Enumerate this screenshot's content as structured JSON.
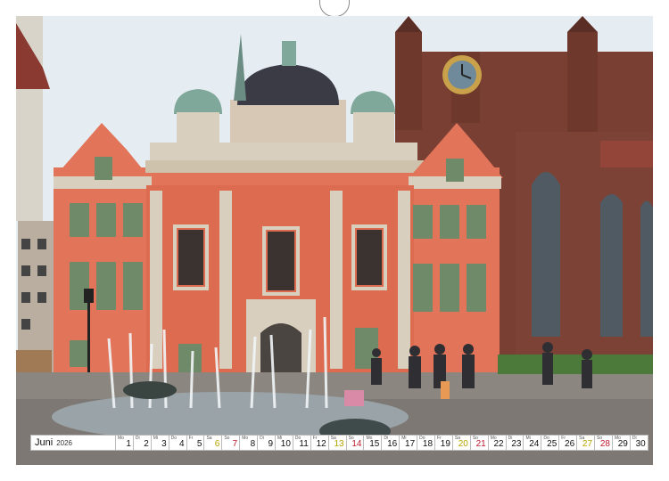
{
  "calendar": {
    "month": "Juni",
    "year": "2026",
    "days": [
      {
        "n": "1",
        "wd": "Mo",
        "type": "work"
      },
      {
        "n": "2",
        "wd": "Di",
        "type": "work"
      },
      {
        "n": "3",
        "wd": "Mi",
        "type": "work"
      },
      {
        "n": "4",
        "wd": "Do",
        "type": "work"
      },
      {
        "n": "5",
        "wd": "Fr",
        "type": "work"
      },
      {
        "n": "6",
        "wd": "Sa",
        "type": "sat"
      },
      {
        "n": "7",
        "wd": "So",
        "type": "sun"
      },
      {
        "n": "8",
        "wd": "Mo",
        "type": "work"
      },
      {
        "n": "9",
        "wd": "Di",
        "type": "work"
      },
      {
        "n": "10",
        "wd": "Mi",
        "type": "work"
      },
      {
        "n": "11",
        "wd": "Do",
        "type": "work"
      },
      {
        "n": "12",
        "wd": "Fr",
        "type": "work"
      },
      {
        "n": "13",
        "wd": "Sa",
        "type": "sat"
      },
      {
        "n": "14",
        "wd": "So",
        "type": "sun"
      },
      {
        "n": "15",
        "wd": "Mo",
        "type": "work"
      },
      {
        "n": "16",
        "wd": "Di",
        "type": "work"
      },
      {
        "n": "17",
        "wd": "Mi",
        "type": "work"
      },
      {
        "n": "18",
        "wd": "Do",
        "type": "work"
      },
      {
        "n": "19",
        "wd": "Fr",
        "type": "work"
      },
      {
        "n": "20",
        "wd": "Sa",
        "type": "sat"
      },
      {
        "n": "21",
        "wd": "So",
        "type": "sun"
      },
      {
        "n": "22",
        "wd": "Mo",
        "type": "work"
      },
      {
        "n": "23",
        "wd": "Di",
        "type": "work"
      },
      {
        "n": "24",
        "wd": "Mi",
        "type": "work"
      },
      {
        "n": "25",
        "wd": "Do",
        "type": "work"
      },
      {
        "n": "26",
        "wd": "Fr",
        "type": "work"
      },
      {
        "n": "27",
        "wd": "Sa",
        "type": "sat"
      },
      {
        "n": "28",
        "wd": "So",
        "type": "sun"
      },
      {
        "n": "29",
        "wd": "Mo",
        "type": "work"
      },
      {
        "n": "30",
        "wd": "Di",
        "type": "work"
      }
    ],
    "colors": {
      "saturday": "#b8a300",
      "sunday": "#c0182b"
    }
  },
  "photo": {
    "colors": {
      "sky": "#e8eef2",
      "facade": "#e2745a",
      "brick": "#7a3f33",
      "roof": "#3c3c44",
      "copper": "#7fa89a",
      "trim": "#d8cfbf",
      "pavement": "#8b8680"
    }
  }
}
